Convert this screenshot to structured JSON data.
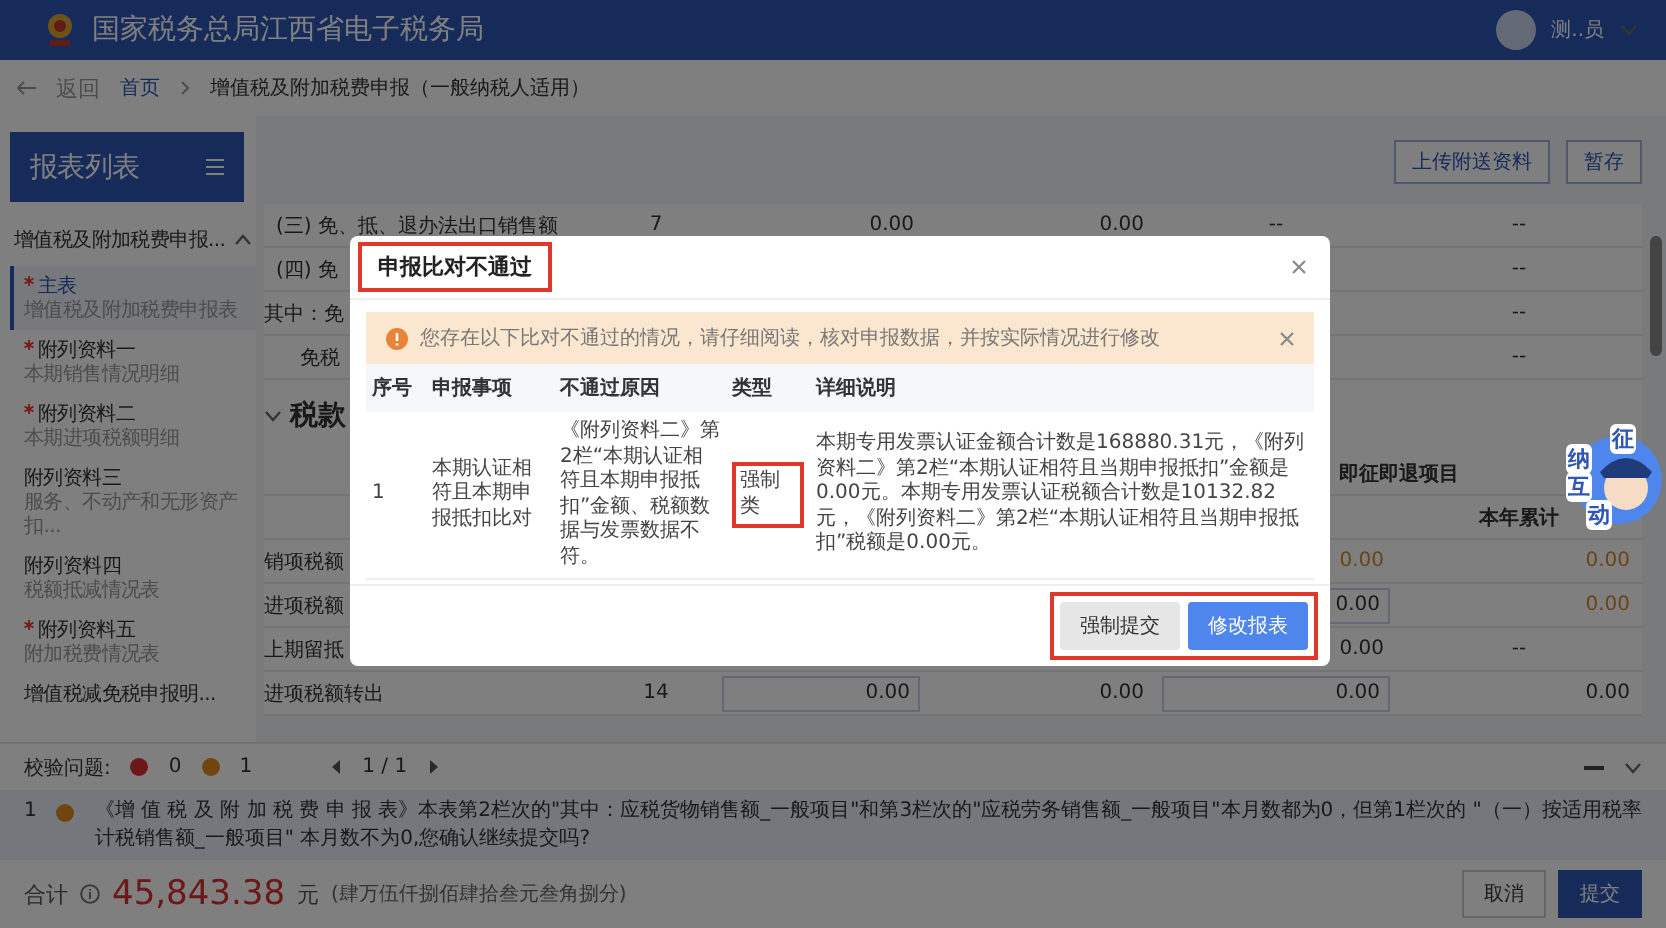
{
  "header": {
    "title": "国家税务总局江西省电子税务局",
    "user": "测..员"
  },
  "breadcrumb": {
    "back": "返回",
    "items": [
      "首页",
      "增值税及附加税费申报（一般纳税人适用）"
    ]
  },
  "sidebar": {
    "title": "报表列表",
    "group": {
      "label": "增值税及附加税费申报...",
      "expanded": true
    },
    "items": [
      {
        "title": "主表",
        "subtitle": "增值税及附加税费申报表",
        "required": true,
        "selected": true
      },
      {
        "title": "附列资料一",
        "subtitle": "本期销售情况明细",
        "required": true,
        "selected": false
      },
      {
        "title": "附列资料二",
        "subtitle": "本期进项税额明细",
        "required": true,
        "selected": false
      },
      {
        "title": "附列资料三",
        "subtitle": "服务、不动产和无形资产扣...",
        "required": false,
        "selected": false
      },
      {
        "title": "附列资料四",
        "subtitle": "税额抵减情况表",
        "required": false,
        "selected": false
      },
      {
        "title": "附列资料五",
        "subtitle": "附加税费情况表",
        "required": true,
        "selected": false
      },
      {
        "title": "增值税减免税申报明...",
        "required": false,
        "selected": false
      }
    ]
  },
  "toolbar": {
    "buttons": [
      "上传附送资料",
      "暂存"
    ]
  },
  "table": {
    "rows_top": [
      {
        "label": "(三) 免、抵、退办法出口销售额",
        "line": "7",
        "kind": "main",
        "cells": [
          {
            "text": "0.00",
            "kind": "text"
          },
          {
            "text": "0.00",
            "kind": "text"
          },
          {
            "text": "--",
            "kind": "text"
          },
          {
            "text": "--",
            "kind": "text"
          }
        ]
      },
      {
        "label": "(四) 免",
        "kind": "main",
        "cells": [
          {
            "text": "--",
            "kind": "text"
          }
        ]
      },
      {
        "label": "其中：免",
        "kind": "lead",
        "cells": [
          {
            "text": "--",
            "kind": "text"
          }
        ]
      },
      {
        "label": "免税",
        "kind": "sub",
        "cells": [
          {
            "text": "--",
            "kind": "text"
          }
        ]
      }
    ],
    "section": {
      "title": "税款",
      "expanded": true
    },
    "group_header": "即征即退项目",
    "sub_header": "本年累计",
    "rows_bottom": [
      {
        "label": "销项税额",
        "kind": "lead",
        "cells": [
          {
            "text": "0.00",
            "kind": "warn"
          },
          {
            "text": "0.00",
            "kind": "warn"
          }
        ]
      },
      {
        "label": "进项税额",
        "kind": "lead",
        "cells": [
          {
            "text": "0.00",
            "kind": "input"
          },
          {
            "text": "0.00",
            "kind": "warn"
          }
        ]
      },
      {
        "label": "上期留抵",
        "kind": "lead",
        "cells": [
          {
            "text": "0.00",
            "kind": "text"
          },
          {
            "text": "--",
            "kind": "text"
          }
        ]
      },
      {
        "label": "进项税额转出",
        "line": "14",
        "kind": "lead",
        "cells": [
          {
            "text": "0.00",
            "kind": "input"
          },
          {
            "text": "0.00",
            "kind": "text"
          },
          {
            "text": "0.00",
            "kind": "input"
          },
          {
            "text": "0.00",
            "kind": "text"
          }
        ]
      }
    ]
  },
  "check_bar": {
    "label": "校验问题:",
    "errors": "0",
    "warnings": "1",
    "page": "1 / 1"
  },
  "message": {
    "index": "1",
    "text": "《增 值 税 及 附 加 税 费 申 报 表》本表第2栏次的\"其中：应税货物销售额_一般项目\"和第3栏次的\"应税劳务销售额_一般项目\"本月数都为0，但第1栏次的 \"（一）按适用税率计税销售额_一般项目\" 本月数不为0,您确认继续提交吗?"
  },
  "footer": {
    "label": "合计",
    "amount": "45,843.38",
    "unit": "元",
    "words": "(肆万伍仟捌佰肆拾叁元叁角捌分)",
    "buttons": [
      "取消",
      "提交"
    ]
  },
  "mascot": {
    "chars": [
      "征",
      "纳",
      "互",
      "动"
    ]
  },
  "modal": {
    "title": "申报比对不通过",
    "title_highlighted": true,
    "alert": "您存在以下比对不通过的情况，请仔细阅读，核对申报数据，并按实际情况进行修改",
    "columns": [
      "序号",
      "申报事项",
      "不通过原因",
      "类型",
      "详细说明"
    ],
    "rows": [
      {
        "index": "1",
        "item": "本期认证相符且本期申报抵扣比对",
        "reason": "《附列资料二》第2栏“本期认证相符且本期申报抵扣”金额、税额数据与发票数据不符。",
        "type": "强制类",
        "type_highlighted": true,
        "detail": "本期专用发票认证金额合计数是168880.31元，《附列资料二》第2栏“本期认证相符且当期申报抵扣”金额是0.00元。本期专用发票认证税额合计数是10132.82元，《附列资料二》第2栏“本期认证相符且当期申报抵扣”税额是0.00元。"
      }
    ],
    "buttons": [
      {
        "label": "强制提交",
        "kind": "secondary"
      },
      {
        "label": "修改报表",
        "kind": "primary"
      }
    ],
    "buttons_highlighted": true
  }
}
